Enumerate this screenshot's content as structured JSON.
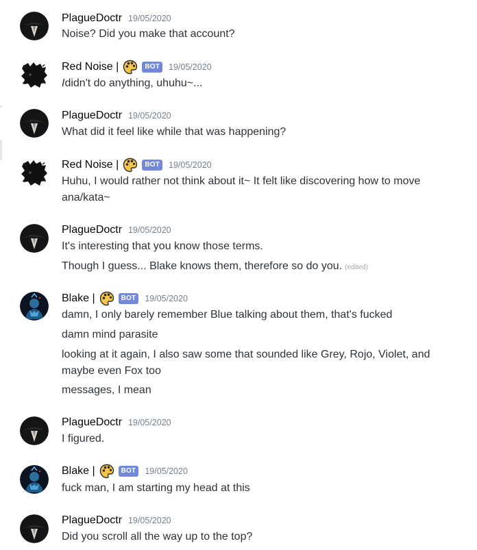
{
  "colors": {
    "bot_tag": "#7289da",
    "username": "#060607",
    "text": "#2e3338",
    "timestamp": "#747f8d"
  },
  "messages": [
    {
      "author": "PlagueDoctr",
      "avatar": "plague-doctor-icon",
      "timestamp": "19/05/2020",
      "lines": [
        "Noise? Did you make that account?"
      ]
    },
    {
      "author": "Red Noise |",
      "avatar": "red-noise-icon",
      "badge_icon": "palette-emoji-icon",
      "bot_tag": "BOT",
      "timestamp": "19/05/2020",
      "lines": [
        "didn't do anything, uhuhu~..."
      ],
      "italic_prefix": "I"
    },
    {
      "author": "PlagueDoctr",
      "avatar": "plague-doctor-icon",
      "timestamp": "19/05/2020",
      "lines": [
        "What did it feel like while that was happening?"
      ]
    },
    {
      "author": "Red Noise |",
      "avatar": "red-noise-icon",
      "badge_icon": "palette-emoji-icon",
      "bot_tag": "BOT",
      "timestamp": "19/05/2020",
      "lines": [
        "Huhu, I would rather not think about it~ It felt like discovering how to move",
        "ana/kata~"
      ]
    },
    {
      "author": "PlagueDoctr",
      "avatar": "plague-doctor-icon",
      "timestamp": "19/05/2020",
      "lines": [
        "It's interesting that you know those terms.",
        "Though I guess... Blake knows them, therefore so do you."
      ],
      "edited": "(edited)"
    },
    {
      "author": "Blake |",
      "avatar": "blake-icon",
      "badge_icon": "palette-emoji-icon",
      "bot_tag": "BOT",
      "timestamp": "19/05/2020",
      "lines": [
        "damn, I only barely remember Blue talking about them, that's fucked",
        "damn mind parasite",
        "looking at it again, I also saw some that sounded like Grey, Rojo, Violet, and",
        "maybe even Fox too",
        "messages, I mean"
      ]
    },
    {
      "author": "PlagueDoctr",
      "avatar": "plague-doctor-icon",
      "timestamp": "19/05/2020",
      "lines": [
        "I figured."
      ]
    },
    {
      "author": "Blake |",
      "avatar": "blake-icon",
      "badge_icon": "palette-emoji-icon",
      "bot_tag": "BOT",
      "timestamp": "19/05/2020",
      "lines": [
        "fuck man, I am starting my head at this"
      ]
    },
    {
      "author": "PlagueDoctr",
      "avatar": "plague-doctor-icon",
      "timestamp": "19/05/2020",
      "lines": [
        "Did you scroll all the way up to the top?"
      ]
    }
  ]
}
